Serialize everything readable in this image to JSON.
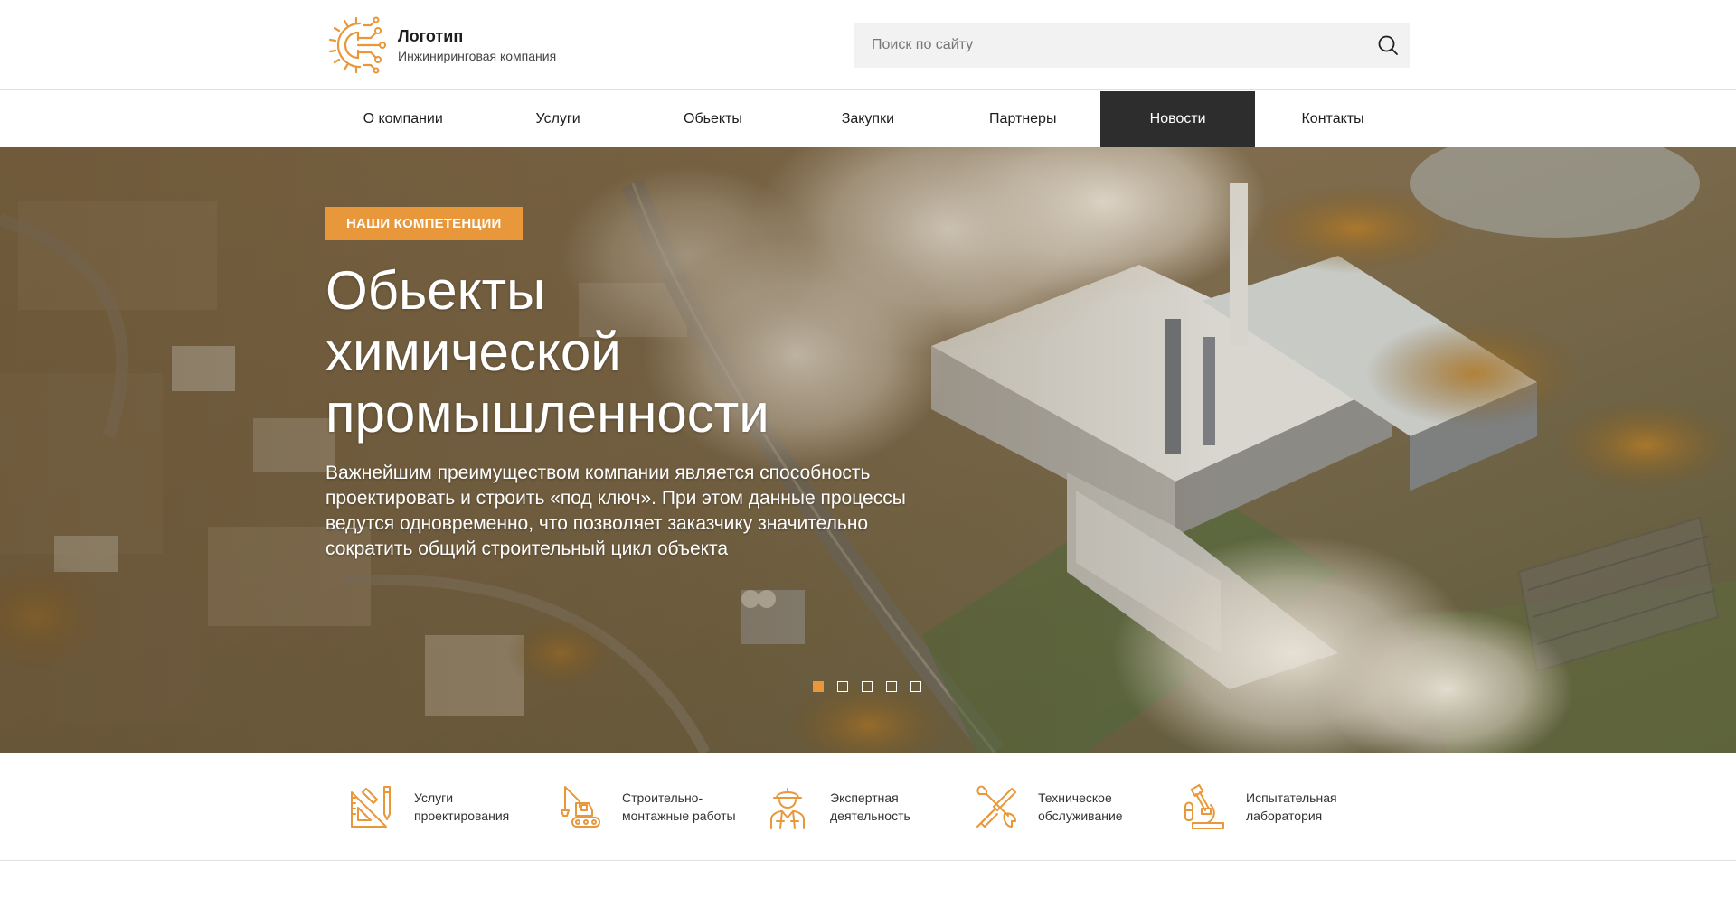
{
  "header": {
    "logo_title": "Логотип",
    "logo_subtitle": "Инжиниринговая компания",
    "search_placeholder": "Поиск по сайту",
    "search_icon": "search-icon"
  },
  "nav": {
    "items": [
      {
        "label": "О компании"
      },
      {
        "label": "Услуги"
      },
      {
        "label": "Обьекты"
      },
      {
        "label": "Закупки"
      },
      {
        "label": "Партнеры"
      },
      {
        "label": "Новости",
        "active": true
      },
      {
        "label": "Контакты"
      }
    ]
  },
  "hero": {
    "badge": "НАШИ КОМПЕТЕНЦИИ",
    "title_lines": [
      "Обьекты",
      "химической",
      "промышленности"
    ],
    "text": "Важнейшим преимуществом компании является способность проектировать и строить «под ключ». При этом данные процессы ведутся одновременно, что позволяет заказчику значительно сократить общий строительный цикл объекта",
    "slides_total": 5,
    "active_slide": 1
  },
  "services": [
    {
      "label": "Услуги\nпроектирования",
      "icon": "drafting-icon"
    },
    {
      "label": "Строительно-\nмонтажные работы",
      "icon": "excavator-icon"
    },
    {
      "label": "Экспертная\nдеятельность",
      "icon": "worker-icon"
    },
    {
      "label": "Техническое\nобслуживание",
      "icon": "wrench-screwdriver-icon"
    },
    {
      "label": "Испытательная\nлаборатория",
      "icon": "microscope-icon"
    }
  ],
  "colors": {
    "accent": "#e8973a",
    "nav_active_bg": "#2d2d2d",
    "search_bg": "#f2f2f2"
  }
}
